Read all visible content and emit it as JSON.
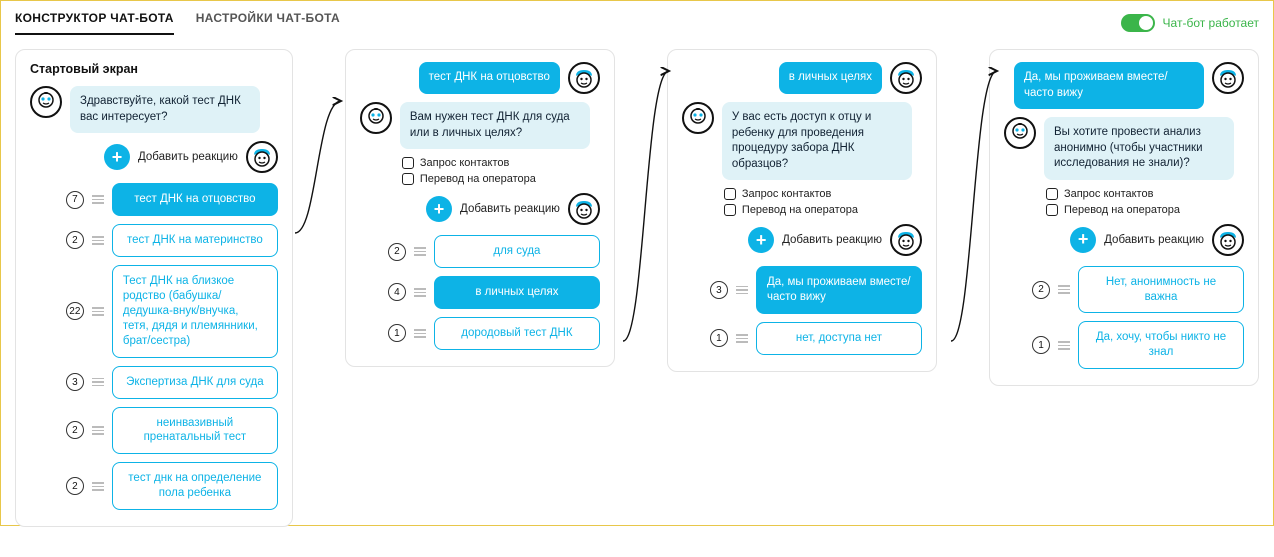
{
  "header": {
    "tabs": {
      "builder": "КОНСТРУКТОР ЧАТ-БОТА",
      "settings": "НАСТРОЙКИ ЧАТ-БОТА"
    },
    "toggle_label": "Чат-бот работает"
  },
  "common": {
    "add_reaction": "Добавить реакцию",
    "check_contacts": "Запрос контактов",
    "check_operator": "Перевод на оператора"
  },
  "panel1": {
    "title": "Стартовый экран",
    "bot_msg": "Здравствуйте, какой тест ДНК вас интересует?",
    "options": [
      {
        "count": "7",
        "label": "тест ДНК на отцовство",
        "selected": true
      },
      {
        "count": "2",
        "label": "тест ДНК на материнство"
      },
      {
        "count": "22",
        "label": "Тест ДНК на близкое родство (бабушка/дедушка-внук/внучка, тетя, дядя и племянники, брат/сестра)"
      },
      {
        "count": "3",
        "label": "Экспертиза ДНК для суда"
      },
      {
        "count": "2",
        "label": "неинвазивный пренатальный тест"
      },
      {
        "count": "2",
        "label": "тест днк на определение пола ребенка"
      }
    ]
  },
  "panel2": {
    "user_msg": "тест ДНК на отцовство",
    "bot_msg": "Вам нужен тест ДНК для суда или в личных целях?",
    "options": [
      {
        "count": "2",
        "label": "для суда"
      },
      {
        "count": "4",
        "label": "в личных целях",
        "selected": true
      },
      {
        "count": "1",
        "label": "дородовый тест ДНК"
      }
    ]
  },
  "panel3": {
    "user_msg": "в личных целях",
    "bot_msg": "У вас есть доступ к отцу и ребенку для проведения процедуру забора ДНК образцов?",
    "options": [
      {
        "count": "3",
        "label": "Да, мы проживаем вместе/часто вижу",
        "selected": true
      },
      {
        "count": "1",
        "label": "нет, доступа нет"
      }
    ]
  },
  "panel4": {
    "user_msg": "Да, мы проживаем вместе/часто вижу",
    "bot_msg": "Вы хотите провести анализ анонимно (чтобы участники исследования не знали)?",
    "options": [
      {
        "count": "2",
        "label": "Нет, анонимность не важна"
      },
      {
        "count": "1",
        "label": "Да, хочу, чтобы никто не знал"
      }
    ]
  }
}
